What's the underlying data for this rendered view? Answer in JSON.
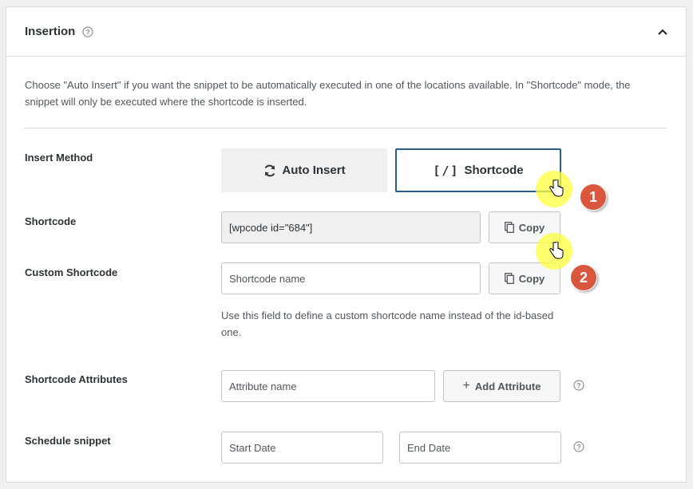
{
  "panel": {
    "title": "Insertion",
    "description": "Choose \"Auto Insert\" if you want the snippet to be automatically executed in one of the locations available. In \"Shortcode\" mode, the snippet will only be executed where the shortcode is inserted."
  },
  "insert_method": {
    "label": "Insert Method",
    "auto_label": "Auto Insert",
    "shortcode_label": "Shortcode",
    "selected": "Shortcode"
  },
  "shortcode": {
    "label": "Shortcode",
    "value": "[wpcode id=\"684\"]",
    "copy_label": "Copy"
  },
  "custom_shortcode": {
    "label": "Custom Shortcode",
    "placeholder": "Shortcode name",
    "copy_label": "Copy",
    "description": "Use this field to define a custom shortcode name instead of the id-based one."
  },
  "attributes": {
    "label": "Shortcode Attributes",
    "placeholder": "Attribute name",
    "add_label": "Add Attribute"
  },
  "schedule": {
    "label": "Schedule snippet",
    "start_placeholder": "Start Date",
    "end_placeholder": "End Date"
  },
  "annotations": {
    "step1": "1",
    "step2": "2"
  },
  "colors": {
    "accent_border": "#2b5d8c",
    "badge": "#d9573d",
    "highlight": "#ffff3c"
  },
  "icons": [
    "help-icon",
    "chevron-up-icon",
    "refresh-icon",
    "shortcode-icon",
    "copy-icon",
    "plus-icon",
    "hand-cursor-icon"
  ]
}
